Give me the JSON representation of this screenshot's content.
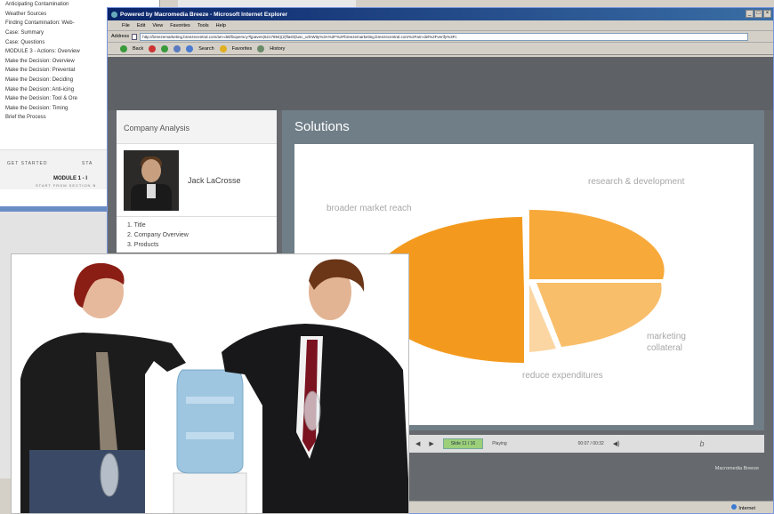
{
  "background_window": {
    "outline": [
      "Anticipating Contamination",
      "Weather Sources",
      "Finding Contamination: Web-",
      "Case: Summary",
      "Case: Questions",
      "MODULE 3 - Actions: Overview",
      "Make the Decision: Overview",
      "Make the Decision: Preventat",
      "Make the Decision: Deciding",
      "Make the Decision: Anti-icing",
      "Make the Decision: Tool & Ore",
      "Make the Decision: Timing",
      "Brief the Process"
    ],
    "controls": [
      "GET STARTED",
      "STA"
    ],
    "module": "MODULE 1 - I",
    "module_sub": "START FROM SECTION B"
  },
  "ie": {
    "title": "Powered by Macromedia Breeze - Microsoft Internet Explorer",
    "window_buttons": [
      "_",
      "□",
      "×"
    ],
    "menu": [
      "File",
      "Edit",
      "View",
      "Favorites",
      "Tools",
      "Help"
    ],
    "address_label": "Address",
    "address_value": "http://breezemarketing.breezecentral.com/am-del/lboperscy?ljpaven(6217894)(2)flash(lusc_urlnWity%3A%2F%2Fbreezemarketing.breezecentral.com%2Fam-del%2Fverify%3Fc",
    "toolbar": [
      "Back",
      "Search",
      "Favorites",
      "History"
    ],
    "status_zone": "Internet"
  },
  "breeze": {
    "sidebar_title": "Company Analysis",
    "presenter_name": "Jack LaCrosse",
    "toc": [
      "1. Title",
      "2. Company Overview",
      "3. Products"
    ],
    "slide_title": "Solutions",
    "pie_labels": {
      "top": "broader market reach",
      "right_top": "research & development",
      "right_bottom": "marketing collateral",
      "bottom": "reduce expenditures"
    },
    "player": {
      "slide_indicator": "Slide 11 / 16",
      "state": "Playing",
      "time": "00:07 / 00:32"
    },
    "brand": "Macromedia Breeze"
  },
  "colors": {
    "pie_dark_orange": "#f39a1e",
    "pie_light_orange": "#f8be6a",
    "pie_pale": "#fbd6a3",
    "ie_title_start": "#0a246a",
    "ie_title_end": "#3a6ea5"
  }
}
